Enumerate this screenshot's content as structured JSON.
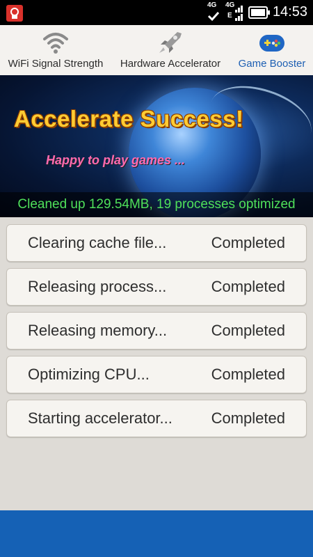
{
  "status_bar": {
    "network_1": "4G",
    "network_2": "4G",
    "network_3": "E",
    "time": "14:53"
  },
  "tabs": [
    {
      "label": "WiFi Signal Strength",
      "icon": "wifi-icon",
      "active": false
    },
    {
      "label": "Hardware Accelerator",
      "icon": "rocket-icon",
      "active": false
    },
    {
      "label": "Game Booster",
      "icon": "gamepad-icon",
      "active": true
    }
  ],
  "banner": {
    "title": "Accelerate Success!",
    "subtitle": "Happy to play games ...",
    "status": "Cleaned up 129.54MB, 19 processes optimized"
  },
  "tasks": [
    {
      "task": "Clearing cache file...",
      "status": "Completed"
    },
    {
      "task": "Releasing process...",
      "status": "Completed"
    },
    {
      "task": "Releasing memory...",
      "status": "Completed"
    },
    {
      "task": "Optimizing CPU...",
      "status": "Completed"
    },
    {
      "task": "Starting accelerator...",
      "status": "Completed"
    }
  ],
  "colors": {
    "accent": "#1561b5",
    "active_tab": "#1d5fb3",
    "status_green": "#4fe05a"
  }
}
